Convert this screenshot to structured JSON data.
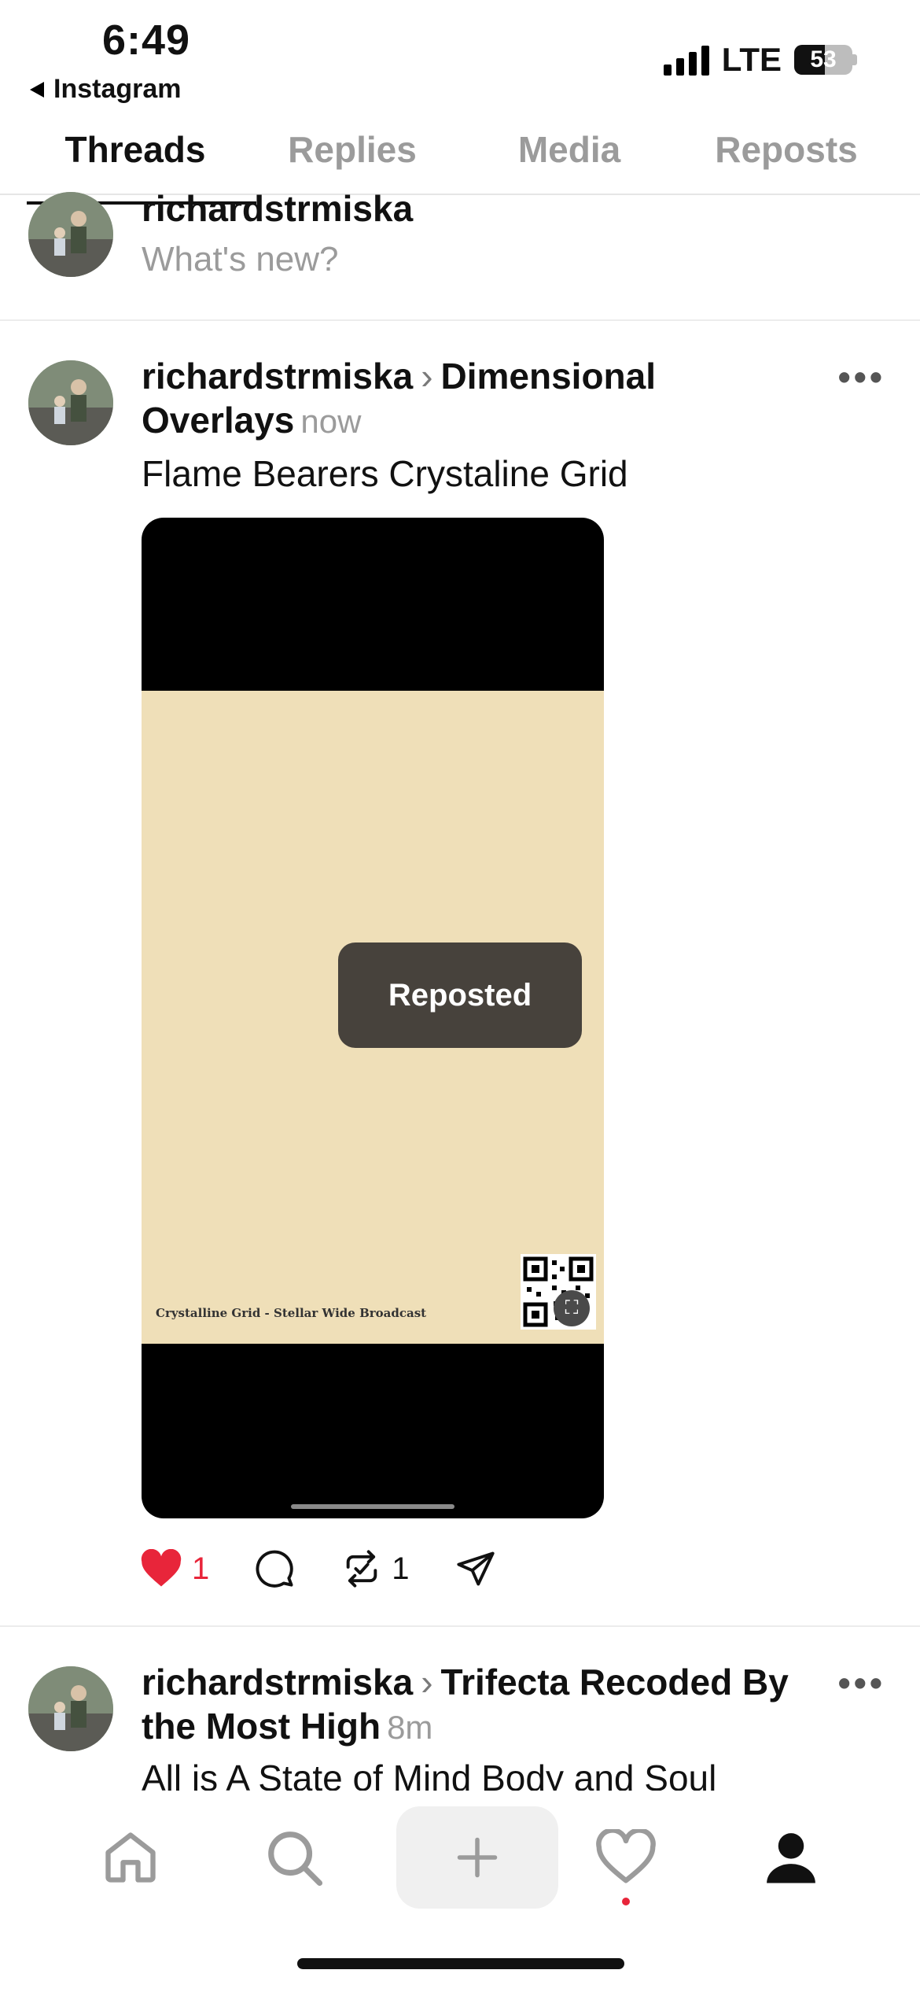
{
  "status_bar": {
    "time": "6:49",
    "back_label": "Instagram",
    "network": "LTE",
    "battery": "53",
    "battery_level": 0.53
  },
  "profile_tabs": [
    {
      "label": "Threads",
      "active": true
    },
    {
      "label": "Replies",
      "active": false
    },
    {
      "label": "Media",
      "active": false
    },
    {
      "label": "Reposts",
      "active": false
    }
  ],
  "composer": {
    "username": "richardstrmiska",
    "prompt": "What's new?"
  },
  "posts": [
    {
      "username": "richardstrmiska",
      "community": "Dimensional Overlays",
      "time": "now",
      "text": "Flame Bearers Crystaline Grid",
      "media_caption": "Crystalline Grid - Stellar Wide Broadcast",
      "likes": "1",
      "reposts": "1",
      "liked": true
    },
    {
      "username": "richardstrmiska",
      "community": "Trifecta Recoded By the Most High",
      "time": "8m",
      "text": "All is A State of Mind Body and Soul"
    }
  ],
  "toast": {
    "label": "Reposted"
  },
  "colors": {
    "like_red": "#e8253a",
    "muted_gray": "#9b9b9b",
    "poster_beige": "#efdfb8"
  },
  "tab_bar_icons": [
    "home-icon",
    "search-icon",
    "create-plus-icon",
    "activity-heart-icon",
    "profile-icon"
  ]
}
